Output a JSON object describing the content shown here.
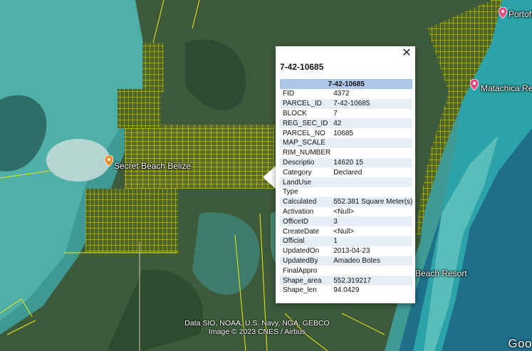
{
  "map": {
    "labels": {
      "secret_beach": "Secret Beach Belize",
      "portofino": "Portofin",
      "matachica": "Matachica Reso",
      "beach_resort": "Beach Resort"
    },
    "attribution_line1": "Data SIO, NOAA, U.S. Navy, NGA, GEBCO",
    "attribution_line2": "Image © 2023 CNES / Airbus",
    "logo_text": "Goo",
    "colors": {
      "parcel_lines": "#f2f20a",
      "shallow_water": "#3fa5a0",
      "land": "#3c5a3c",
      "pin_orange": "#f08a24",
      "pin_pink": "#e24a86"
    }
  },
  "popup": {
    "title": "7-42-10685",
    "header": "7-42-10685",
    "close_icon": "close-icon",
    "rows": [
      {
        "key": "FID",
        "value": "4372"
      },
      {
        "key": "PARCEL_ID",
        "value": "7-42-10685"
      },
      {
        "key": "BLOCK",
        "value": "7"
      },
      {
        "key": "REG_SEC_ID",
        "value": "42"
      },
      {
        "key": "PARCEL_NO",
        "value": "10685"
      },
      {
        "key": "MAP_SCALE",
        "value": ""
      },
      {
        "key": "RIM_NUMBER",
        "value": ""
      },
      {
        "key": "Descriptio",
        "value": "14620 15"
      },
      {
        "key": "Category",
        "value": "Declared"
      },
      {
        "key": "LandUse",
        "value": ""
      },
      {
        "key": "Type",
        "value": ""
      },
      {
        "key": "Calculated",
        "value": "552.381 Square Meter(s)"
      },
      {
        "key": "Activation",
        "value": "<Null>"
      },
      {
        "key": "OfficeID",
        "value": "3"
      },
      {
        "key": "CreateDate",
        "value": "<Null>"
      },
      {
        "key": "Official",
        "value": "1"
      },
      {
        "key": "UpdatedOn",
        "value": "2013-04-23"
      },
      {
        "key": "UpdatedBy",
        "value": "Amadeo Botes"
      },
      {
        "key": "FinalAppro",
        "value": ""
      },
      {
        "key": "Shape_area",
        "value": "552.319217"
      },
      {
        "key": "Shape_len",
        "value": "94.0429"
      }
    ]
  }
}
